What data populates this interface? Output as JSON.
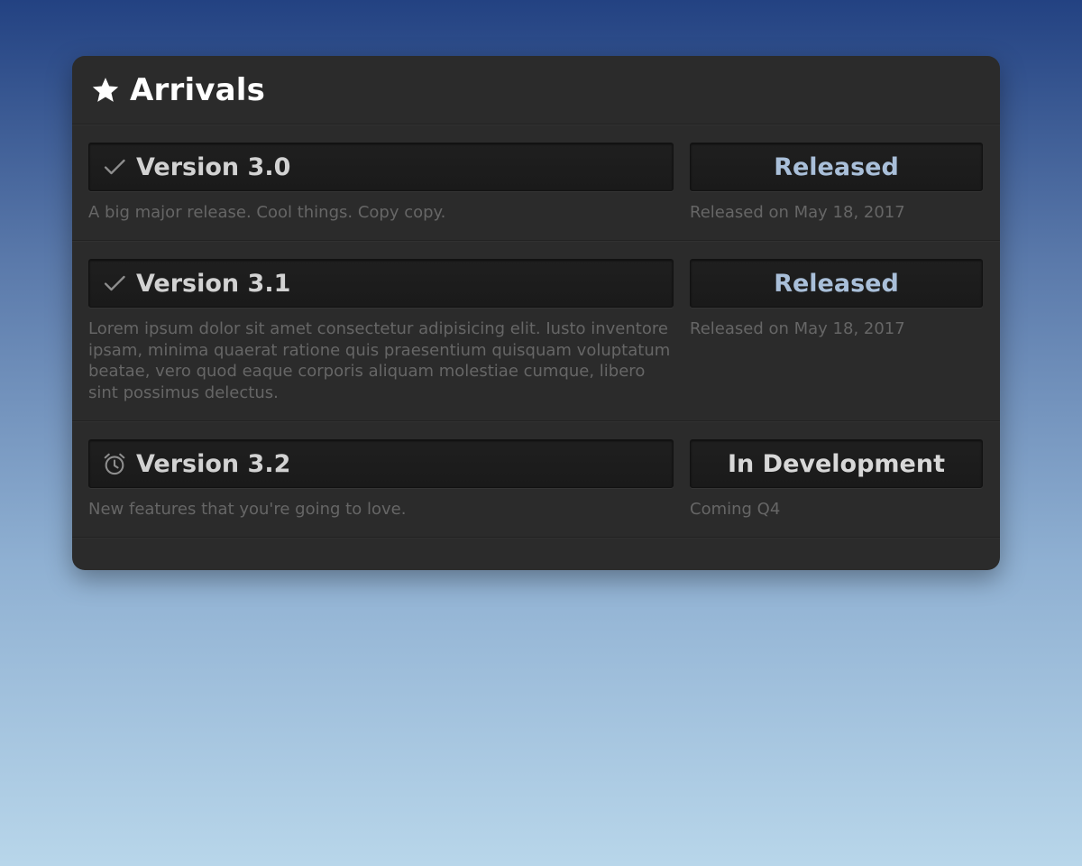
{
  "panel": {
    "title": "Arrivals",
    "title_icon": "star-icon"
  },
  "colors": {
    "released": "#a9bfd9",
    "in_development": "#d8d8d8",
    "version_text": "#d2d2d2",
    "muted_text": "#666666"
  },
  "versions": [
    {
      "name": "Version 3.0",
      "icon": "check-icon",
      "status": "Released",
      "description": "A big major release. Cool things. Copy copy.",
      "date": "Released on May 18, 2017"
    },
    {
      "name": "Version 3.1",
      "icon": "check-icon",
      "status": "Released",
      "description": "Lorem ipsum dolor sit amet consectetur adipisicing elit. Iusto inventore ipsam, minima quaerat ratione quis praesentium quisquam voluptatum beatae, vero quod eaque corporis aliquam molestiae cumque, libero sint possimus delectus.",
      "date": "Released on May 18, 2017"
    },
    {
      "name": "Version 3.2",
      "icon": "alarm-clock-icon",
      "status": "In Development",
      "description": "New features that you're going to love.",
      "date": "Coming Q4"
    }
  ]
}
